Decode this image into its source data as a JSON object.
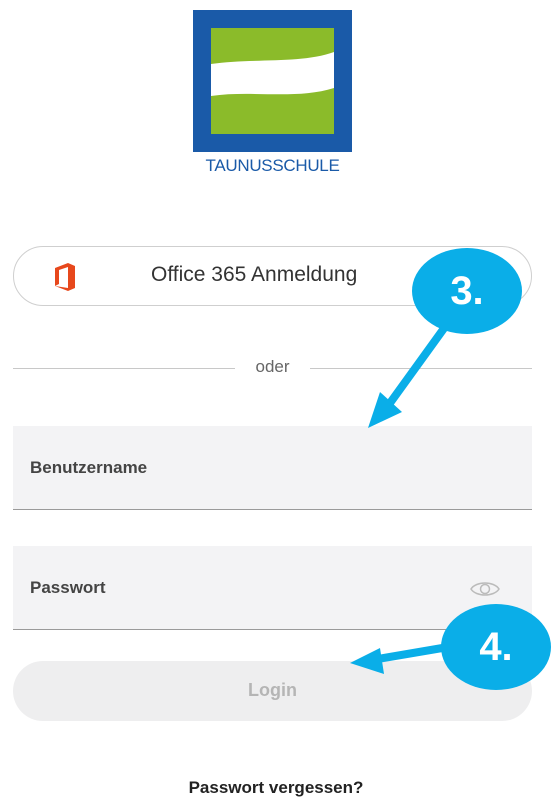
{
  "logo": {
    "text": "TAUNUSSCHULE"
  },
  "office_button": {
    "label": "Office 365 Anmeldung"
  },
  "divider": {
    "text": "oder"
  },
  "username": {
    "placeholder": "Benutzername"
  },
  "password": {
    "placeholder": "Passwort"
  },
  "login": {
    "label": "Login"
  },
  "forgot": {
    "label": "Passwort vergessen?"
  },
  "annotations": {
    "step3": "3.",
    "step4": "4."
  },
  "colors": {
    "brand_blue": "#1a5aa8",
    "logo_green": "#8bbb2a",
    "office_red": "#e7481c",
    "badge_blue": "#0aaee8"
  },
  "icons": {
    "office": "office-logo-icon",
    "password_visibility": "eye-icon"
  }
}
